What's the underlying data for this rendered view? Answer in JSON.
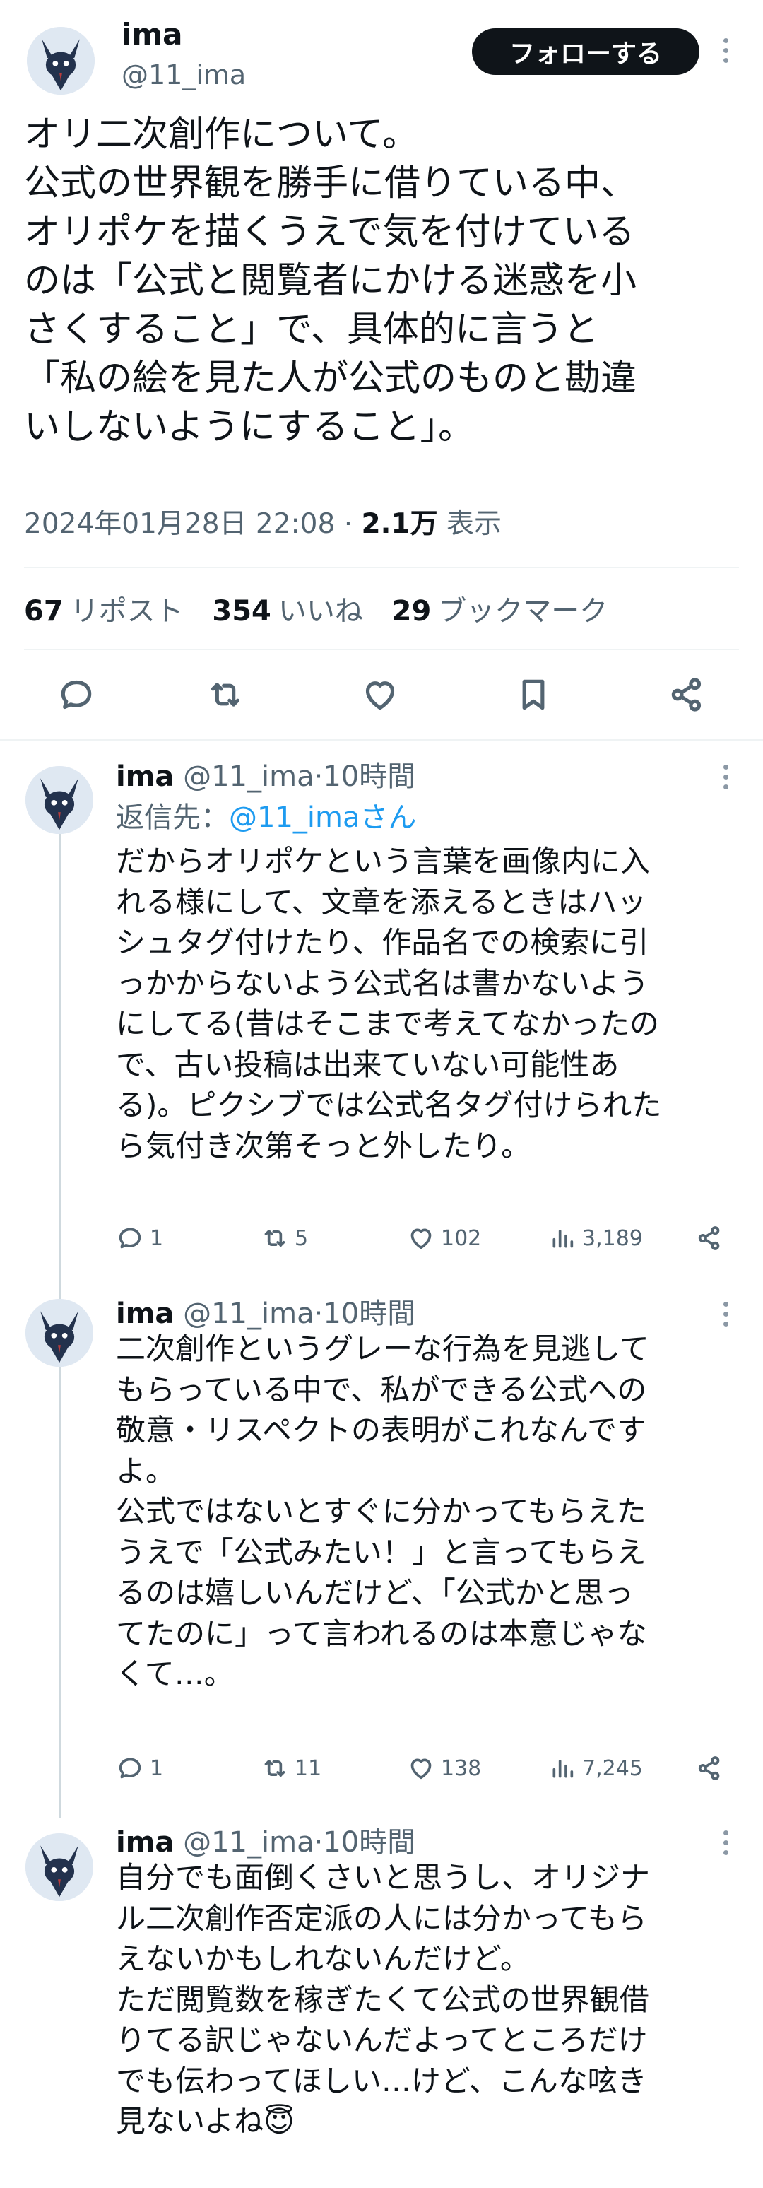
{
  "main": {
    "name": "ima",
    "handle": "@11_ima",
    "follow_label": "フォローする",
    "text": "オリ二次創作について。\n公式の世界観を勝手に借りている中、\nオリポケを描くうえで気を付けている\nのは「公式と閲覧者にかける迷惑を小\nさくすること」で、具体的に言うと\n「私の絵を見た人が公式のものと勘違\nいしないようにすること」。",
    "timestamp": "2024年01月28日 22:08",
    "sep": "·",
    "views_count": "2.1万",
    "views_label": "表示",
    "stats": {
      "reposts_count": "67",
      "reposts_label": "リポスト",
      "likes_count": "354",
      "likes_label": "いいね",
      "bookmarks_count": "29",
      "bookmarks_label": "ブックマーク"
    },
    "actions": [
      "reply-icon",
      "repost-icon",
      "like-icon",
      "bookmark-icon",
      "share-icon"
    ]
  },
  "replies": [
    {
      "name": "ima",
      "handle": "@11_ima",
      "sep": "·",
      "time": "10時間",
      "reply_to_label": "返信先：",
      "reply_to_user": "@11_imaさん",
      "text": "だからオリポケという言葉を画像内に入\nれる様にして、文章を添えるときはハッ\nシュタグ付けたり、作品名での検索に引\nっかからないよう公式名は書かないよう\nにしてる(昔はそこまで考えてなかったの\nで、古い投稿は出来ていない可能性あ\nる)。ピクシブでは公式名タグ付けられた\nら気付き次第そっと外したり。",
      "replies": "1",
      "reposts": "5",
      "likes": "102",
      "views": "3,189"
    },
    {
      "name": "ima",
      "handle": "@11_ima",
      "sep": "·",
      "time": "10時間",
      "text": "二次創作というグレーな行為を見逃して\nもらっている中で、私ができる公式への\n敬意・リスペクトの表明がこれなんです\nよ。\n公式ではないとすぐに分かってもらえた\nうえで「公式みたい！」と言ってもらえ\nるのは嬉しいんだけど、「公式かと思っ\nてたのに」って言われるのは本意じゃな\nくて…。",
      "replies": "1",
      "reposts": "11",
      "likes": "138",
      "views": "7,245"
    },
    {
      "name": "ima",
      "handle": "@11_ima",
      "sep": "·",
      "time": "10時間",
      "text": "自分でも面倒くさいと思うし、オリジナ\nル二次創作否定派の人には分かってもら\nえないかもしれないんだけど。\nただ閲覧数を稼ぎたくて公式の世界観借\nりてる訳じゃないんだよってところだけ\nでも伝わってほしい…けど、こんな呟き\n見ないよね😇"
    }
  ],
  "colors": {
    "text": "#0f1419",
    "muted": "#536471",
    "link": "#1d9bf0",
    "border": "#eff3f4",
    "button_bg": "#0f1419"
  }
}
